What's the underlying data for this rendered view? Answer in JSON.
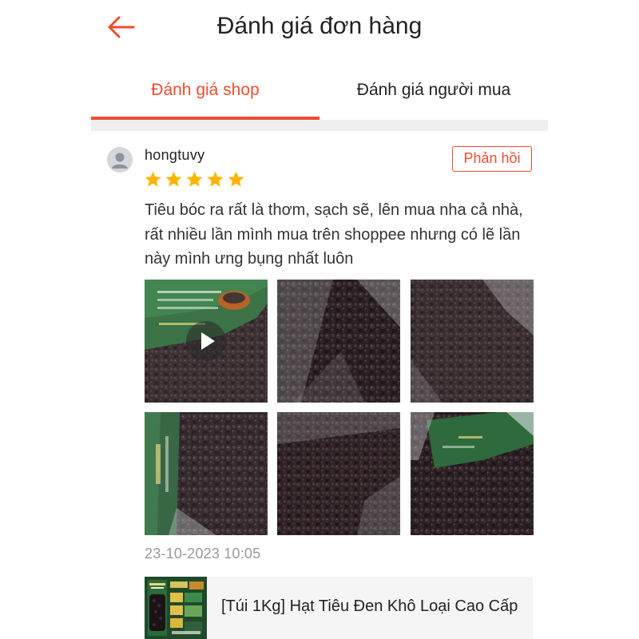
{
  "header": {
    "title": "Đánh giá đơn hàng",
    "back_icon": "arrow-left-icon",
    "accent_color": "#ee4d2d"
  },
  "tabs": [
    {
      "label": "Đánh giá shop",
      "active": true
    },
    {
      "label": "Đánh giá người mua",
      "active": false
    }
  ],
  "review": {
    "username": "hongtuvy",
    "rating": 5,
    "reply_label": "Phản hồi",
    "text": "Tiêu bóc ra rất là thơm, sạch sẽ, lên mua nha cả nhà, rất nhiều lần mình mua trên shoppee nhưng có lẽ lần này mình ưng bụng nhất luôn",
    "media_count": 6,
    "first_media_is_video": true,
    "timestamp": "23-10-2023 10:05"
  },
  "product": {
    "name": "[Túi 1Kg] Hạt Tiêu Đen Khô Loại Cao Cấp",
    "thumb_icon": "product-thumbnail"
  }
}
